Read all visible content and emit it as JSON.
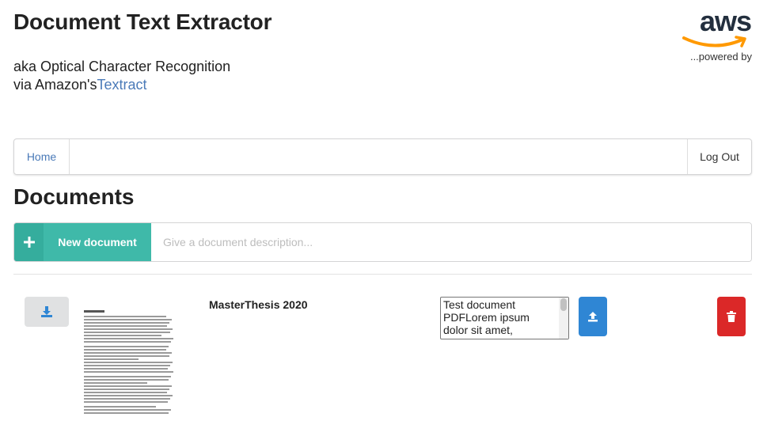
{
  "header": {
    "title": "Document Text Extractor",
    "subtitle_line1": "aka Optical Character Recognition",
    "subtitle_line2_prefix": "via Amazon's",
    "subtitle_link": "Textract"
  },
  "branding": {
    "logo_text": "aws",
    "powered_by": "...powered by"
  },
  "nav": {
    "home": "Home",
    "logout": "Log Out"
  },
  "documents": {
    "title": "Documents",
    "new_button_icon": "plus-icon",
    "new_button_label": "New document",
    "description_placeholder": "Give a document description...",
    "items": [
      {
        "name": "MasterThesis 2020",
        "thumbnail_title": "Test document PDF",
        "text": "Test document PDFLorem ipsum dolor sit amet, consectetur",
        "download_icon": "download-icon",
        "upload_icon": "upload-icon",
        "delete_icon": "trash-icon"
      }
    ]
  },
  "colors": {
    "accent_teal": "#3fb9a9",
    "primary_blue": "#2f86d4",
    "danger_red": "#db2828",
    "link_blue": "#4a7ab8",
    "aws_dark": "#232f3e",
    "aws_orange": "#f90"
  }
}
